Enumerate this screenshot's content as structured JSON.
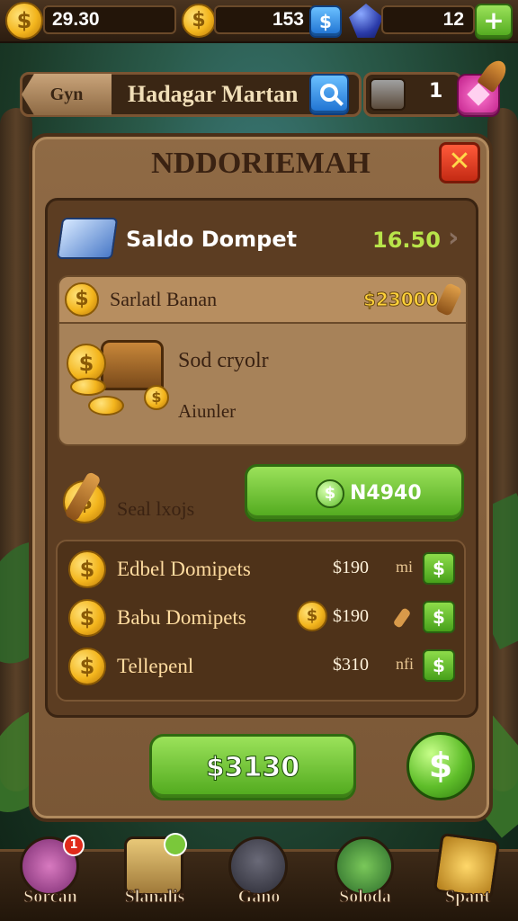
{
  "topbar": {
    "coins": "29.30",
    "gems": "153",
    "gems_btn_icon": "$",
    "crystals": "12",
    "add_icon": "+"
  },
  "header": {
    "back_label": "Gyn",
    "title": "Hadagar Martan",
    "chest_count": "1"
  },
  "panel": {
    "title": "NDDORIEMAH",
    "close_icon": "✕",
    "wallet": {
      "label": "Saldo Dompet",
      "value": "16.50"
    },
    "bank": {
      "label": "Sarlatl Banan",
      "value": "$23000"
    },
    "treasure": {
      "line1": "Sod cryolr",
      "line2": "Aiunler"
    },
    "action": {
      "label": "Seal lxojs",
      "button_value": "N4940",
      "button_icon": "$"
    },
    "rows": [
      {
        "label": "Edbel Domipets",
        "amount": "$190",
        "suffix": "mi",
        "buy_icon": "$"
      },
      {
        "label": "Babu Domipets",
        "amount": "$190",
        "suffix": "",
        "buy_icon": "$"
      },
      {
        "label": "Tellepenl",
        "amount": "$310",
        "suffix": "nfi",
        "buy_icon": "$"
      }
    ],
    "total_button": "$3130",
    "coin_button_icon": "$"
  },
  "nav": [
    {
      "label": "Sorcan",
      "badge": "1"
    },
    {
      "label": "Slanalis",
      "badge": ""
    },
    {
      "label": "Gano",
      "badge": ""
    },
    {
      "label": "Soloda",
      "badge": ""
    },
    {
      "label": "Spant",
      "badge": ""
    }
  ],
  "colors": {
    "accent_green": "#4fa81c",
    "panel_brown": "#7a5736",
    "coin_gold": "#f3b51d",
    "close_red": "#c42a14"
  }
}
